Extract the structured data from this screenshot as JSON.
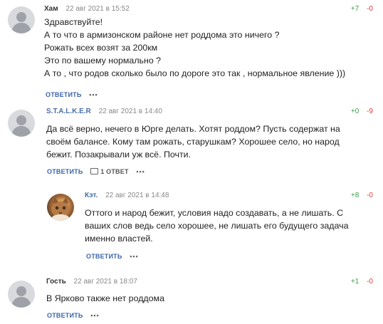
{
  "comments": [
    {
      "author": "Хам",
      "date": "22 авг 2021 в 15:52",
      "up": "+7",
      "down": "-0",
      "lines": [
        "Здравствуйте!",
        "А то что в армизонском районе нет роддома это ничего ?",
        "Рожать всех возят за 200км",
        "Это по вашему нормально ?",
        "А то , что родов сколько было по дороге это так , нормальное явление )))"
      ],
      "reply_label": "ОТВЕТИТЬ",
      "more_label": "•••"
    },
    {
      "author": "S.T.A.L.K.E.R",
      "date": "22 авг 2021 в 14:40",
      "up": "+0",
      "down": "-9",
      "lines": [
        "Да всё верно, нечего в Юрге делать. Хотят роддом? Пусть содержат на",
        "своём балансе. Кому там рожать, старушкам? Хорошее село, но народ",
        "бежит. Позакрывали уж всё. Почти."
      ],
      "reply_label": "ОТВЕТИТЬ",
      "answers_label": "1 ОТВЕТ",
      "more_label": "•••"
    },
    {
      "author": "Кэт.",
      "date": "22 авг 2021 в 14:48",
      "up": "+8",
      "down": "-0",
      "lines": [
        "Оттого и народ бежит, условия надо создавать, а не лишать. С",
        "ваших слов ведь село хорошее, не лишать его будущего задача",
        "именно властей."
      ],
      "reply_label": "ОТВЕТИТЬ",
      "more_label": "•••"
    },
    {
      "author": "Гость",
      "date": "22 авг 2021 в 18:07",
      "up": "+1",
      "down": "-0",
      "lines": [
        "В Ярково также нет роддома"
      ],
      "reply_label": "ОТВЕТИТЬ",
      "more_label": "•••"
    }
  ],
  "colors": {
    "upvote": "#3aa04a",
    "downvote": "#d93a3a",
    "reply_link": "#3b64a8",
    "author_link": "#4a6fa5"
  },
  "icons": {
    "default_avatar": "user-silhouette-icon",
    "answers": "comment-bubble-icon"
  }
}
